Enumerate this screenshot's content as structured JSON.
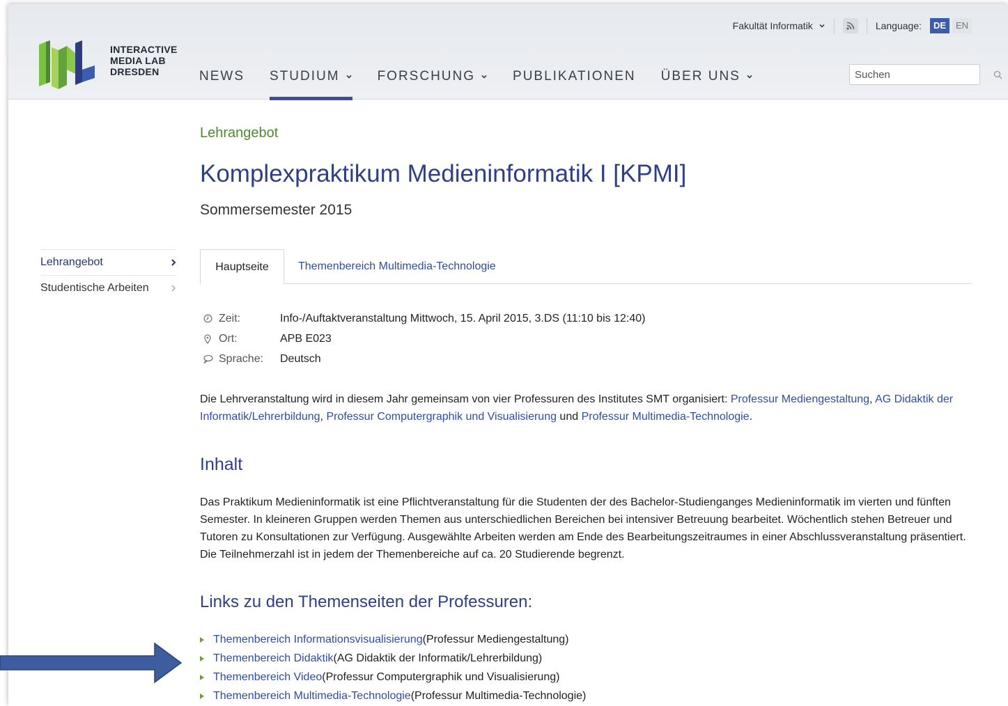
{
  "header": {
    "logo_lines": [
      "INTERACTIVE",
      "MEDIA LAB",
      "DRESDEN"
    ],
    "faculty_label": "Fakultät Informatik",
    "language_label": "Language:",
    "languages": [
      {
        "code": "DE",
        "active": true
      },
      {
        "code": "EN",
        "active": false
      }
    ],
    "nav": [
      {
        "label": "NEWS",
        "dropdown": false,
        "active": false
      },
      {
        "label": "STUDIUM",
        "dropdown": true,
        "active": true
      },
      {
        "label": "FORSCHUNG",
        "dropdown": true,
        "active": false
      },
      {
        "label": "PUBLIKATIONEN",
        "dropdown": false,
        "active": false
      },
      {
        "label": "ÜBER UNS",
        "dropdown": true,
        "active": false
      }
    ],
    "search_placeholder": "Suchen"
  },
  "sidebar": {
    "items": [
      {
        "label": "Lehrangebot",
        "active": true
      },
      {
        "label": "Studentische Arbeiten",
        "active": false
      }
    ]
  },
  "main": {
    "breadcrumb": "Lehrangebot",
    "title": "Komplexpraktikum Medieninformatik I [KPMI]",
    "subtitle": "Sommersemester 2015",
    "tabs": [
      {
        "label": "Hauptseite",
        "active": true
      },
      {
        "label": "Themenbereich Multimedia-Technologie",
        "active": false
      }
    ],
    "info": [
      {
        "icon": "clock-icon",
        "label": "Zeit:",
        "value": "Info-/Auftaktveranstaltung Mittwoch, 15. April 2015, 3.DS (11:10 bis 12:40)"
      },
      {
        "icon": "map-pin-icon",
        "label": "Ort:",
        "value": "APB E023"
      },
      {
        "icon": "speech-bubble-icon",
        "label": "Sprache:",
        "value": "Deutsch"
      }
    ],
    "intro": {
      "text_before": "Die Lehrveranstaltung wird in diesem Jahr gemeinsam von vier Professuren des Institutes SMT organisiert: ",
      "link1": "Professur Mediengestaltung",
      "sep1": ", ",
      "link2": "AG Didaktik der Informatik/Lehrerbildung",
      "sep2": ", ",
      "link3": "Professur Computergraphik und Visualisierung",
      "sep3": " und ",
      "link4": "Professur Multimedia-Technologie",
      "end": "."
    },
    "inhalt_heading": "Inhalt",
    "inhalt_text": "Das Praktikum Medieninformatik ist eine Pflichtveranstaltung für die Studenten der des Bachelor-Studienganges Medieninformatik im vierten und fünften Semester. In kleineren Gruppen werden Themen aus unterschiedlichen Bereichen bei intensiver Betreuung bearbeitet. Wöchentlich stehen Betreuer und Tutoren zu Konsultationen zur Verfügung. Ausgewählte Arbeiten werden am Ende des Bearbeitungszeitraumes in einer Abschlussveranstaltung präsentiert. Die Teilnehmerzahl ist in jedem der Themenbereiche auf ca. 20 Studierende begrenzt.",
    "links_heading": "Links zu den Themenseiten der Professuren:",
    "links": [
      {
        "link": "Themenbereich Informationsvisualisierung",
        "note": " (Professur Mediengestaltung)"
      },
      {
        "link": "Themenbereich Didaktik",
        "note": " (AG Didaktik der Informatik/Lehrerbildung)"
      },
      {
        "link": "Themenbereich Video",
        "note": " (Professur Computergraphik und Visualisierung)"
      },
      {
        "link": "Themenbereich Multimedia-Technologie",
        "note": " (Professur Multimedia-Technologie)"
      }
    ]
  },
  "colors": {
    "accent_blue": "#2f3f86",
    "link_blue": "#2f4da0",
    "green": "#4d8a2d",
    "annotation_arrow": "#3d5d9e"
  }
}
